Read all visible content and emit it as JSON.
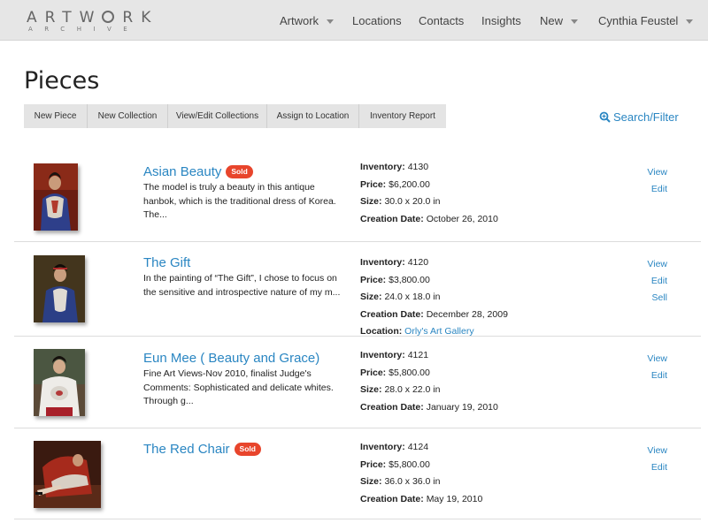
{
  "logo": {
    "top": "ARTW",
    "top2": "RK",
    "bottom": "ARCHIVE"
  },
  "nav": {
    "artwork": "Artwork",
    "locations": "Locations",
    "contacts": "Contacts",
    "insights": "Insights",
    "new": "New",
    "user": "Cynthia Feustel"
  },
  "page": {
    "title": "Pieces"
  },
  "toolbar": {
    "new_piece": "New Piece",
    "new_collection": "New Collection",
    "view_edit_collections": "View/Edit Collections",
    "assign_location": "Assign to Location",
    "inventory_report": "Inventory Report"
  },
  "search_filter": "Search/Filter",
  "labels": {
    "inventory": "Inventory:",
    "price": "Price:",
    "size": "Size:",
    "creation_date": "Creation Date:",
    "location": "Location:",
    "view": "View",
    "edit": "Edit",
    "sell": "Sell",
    "sold": "Sold"
  },
  "pieces": [
    {
      "title": "Asian Beauty",
      "sold": true,
      "description": "The model is truly a beauty in this antique\nhanbok, which is the traditional dress of Korea.\nThe...",
      "inventory": "4130",
      "price": "$6,200.00",
      "size": "30.0 x 20.0 in",
      "creation_date": "October 26, 2010"
    },
    {
      "title": "The Gift",
      "sold": false,
      "description": "In the painting of “The Gift”, I chose to focus on\nthe sensitive and introspective nature of my m...",
      "inventory": "4120",
      "price": "$3,800.00",
      "size": "24.0 x 18.0 in",
      "creation_date": "December 28, 2009",
      "location": "Orly's Art Gallery"
    },
    {
      "title": "Eun Mee ( Beauty and Grace)",
      "sold": false,
      "description": "Fine Art Views-Nov 2010, finalist Judge's\nComments: Sophisticated and delicate whites.\nThrough g...",
      "inventory": "4121",
      "price": "$5,800.00",
      "size": "28.0 x 22.0 in",
      "creation_date": "January 19, 2010"
    },
    {
      "title": "The Red Chair",
      "sold": true,
      "description": "",
      "inventory": "4124",
      "price": "$5,800.00",
      "size": "36.0 x 36.0 in",
      "creation_date": "May 19, 2010"
    }
  ],
  "colors": {
    "link": "#2a86c2",
    "sold_badge": "#e8452c",
    "header_bg": "#e6e6e6"
  }
}
